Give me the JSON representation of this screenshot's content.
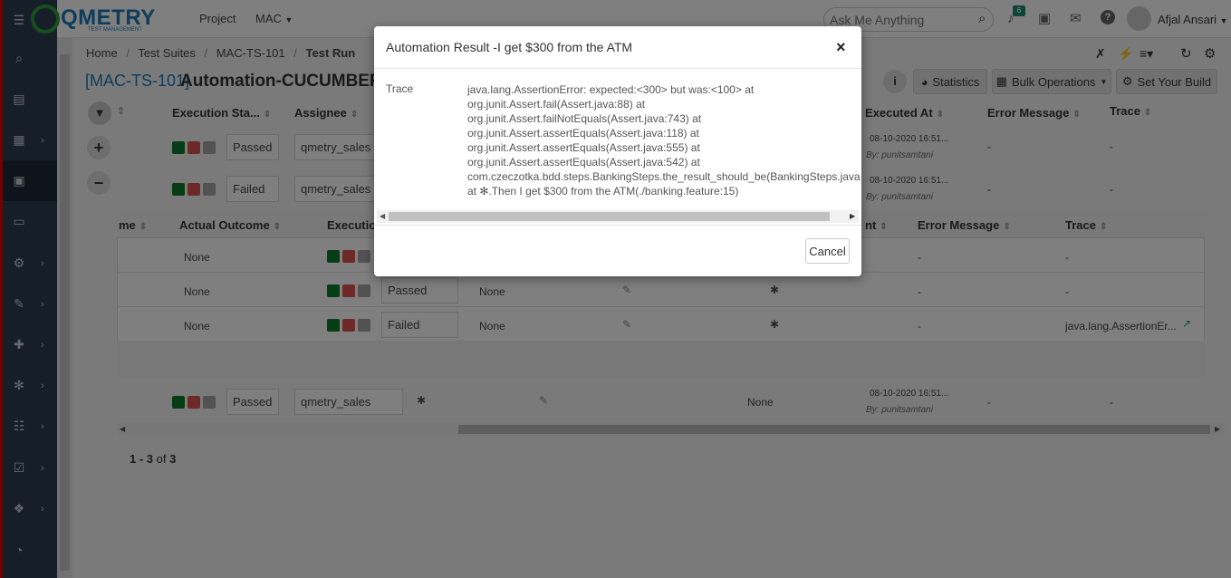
{
  "topbar": {
    "logo": "QMETRY",
    "logo_sub": "TEST MANAGEMENT",
    "project_label": "Project",
    "project_value": "MAC",
    "search_placeholder": "Ask Me Anything",
    "notifications_count": "6",
    "user_name": "Afjal Ansari"
  },
  "breadcrumb": [
    "Home",
    "Test Suites",
    "MAC-TS-101",
    "Test Run"
  ],
  "page": {
    "key": "[MAC-TS-101]",
    "title": "Automation-CUCUMBER-"
  },
  "toolbar": {
    "statistics": "Statistics",
    "bulk_operations": "Bulk Operations",
    "set_build": "Set Your Build"
  },
  "outer_headers": [
    "Execution Sta...",
    "Assignee",
    "Executed At",
    "Error Message",
    "Trace"
  ],
  "outer_rows": [
    {
      "status": "Passed",
      "assignee": "qmetry_sales",
      "executed_at": "08-10-2020 16:51...",
      "executed_by": "By: punitsamtani",
      "error": "-",
      "trace": "-"
    },
    {
      "status": "Failed",
      "assignee": "qmetry_sales",
      "executed_at": "08-10-2020 16:51...",
      "executed_by": "By: punitsamtani",
      "error": "-",
      "trace": "-"
    },
    {
      "status": "Passed",
      "assignee": "qmetry_sales",
      "none": "None",
      "executed_at": "08-10-2020 16:51...",
      "executed_by": "By: punitsamtani",
      "error": "-",
      "trace": "-"
    }
  ],
  "inner_headers": [
    "me",
    "Actual Outcome",
    "Executio",
    "nt",
    "Error Message",
    "Trace"
  ],
  "inner_rows": [
    {
      "actual": "None",
      "status": "",
      "col": "",
      "error": "-",
      "trace": "-"
    },
    {
      "actual": "None",
      "status": "Passed",
      "col": "None",
      "error": "-",
      "trace": "-"
    },
    {
      "actual": "None",
      "status": "Failed",
      "col": "None",
      "error": "-",
      "trace": "java.lang.AssertionEr..."
    }
  ],
  "pagination": {
    "range": "1 - 3",
    "of": "of",
    "total": "3"
  },
  "modal": {
    "title": "Automation Result -I get $300 from the ATM",
    "close": "×",
    "trace_label": "Trace",
    "trace_lines": [
      "java.lang.AssertionError: expected:<300> but was:<100> at",
      "org.junit.Assert.fail(Assert.java:88) at",
      "org.junit.Assert.failNotEquals(Assert.java:743) at",
      "org.junit.Assert.assertEquals(Assert.java:118) at",
      "org.junit.Assert.assertEquals(Assert.java:555) at",
      "org.junit.Assert.assertEquals(Assert.java:542) at",
      "com.czeczotka.bdd.steps.BankingSteps.the_result_should_be(BankingSteps.java",
      "at ✻.Then I get $300 from the ATM(./banking.feature:15)"
    ],
    "cancel": "Cancel"
  },
  "sidebar_icons": [
    "search-icon",
    "list-icon",
    "grid-icon",
    "archive-icon",
    "card-icon",
    "gears-icon",
    "wrench-icon",
    "puzzle-icon",
    "gear-icon",
    "tasks-icon",
    "checkbox-icon",
    "cubes-icon",
    "dashboard-icon"
  ],
  "colors": {
    "sidebar": "#2d3e50",
    "accent": "#1a7ab5",
    "passed": "#0f7a2a",
    "failed": "#d9534f"
  }
}
